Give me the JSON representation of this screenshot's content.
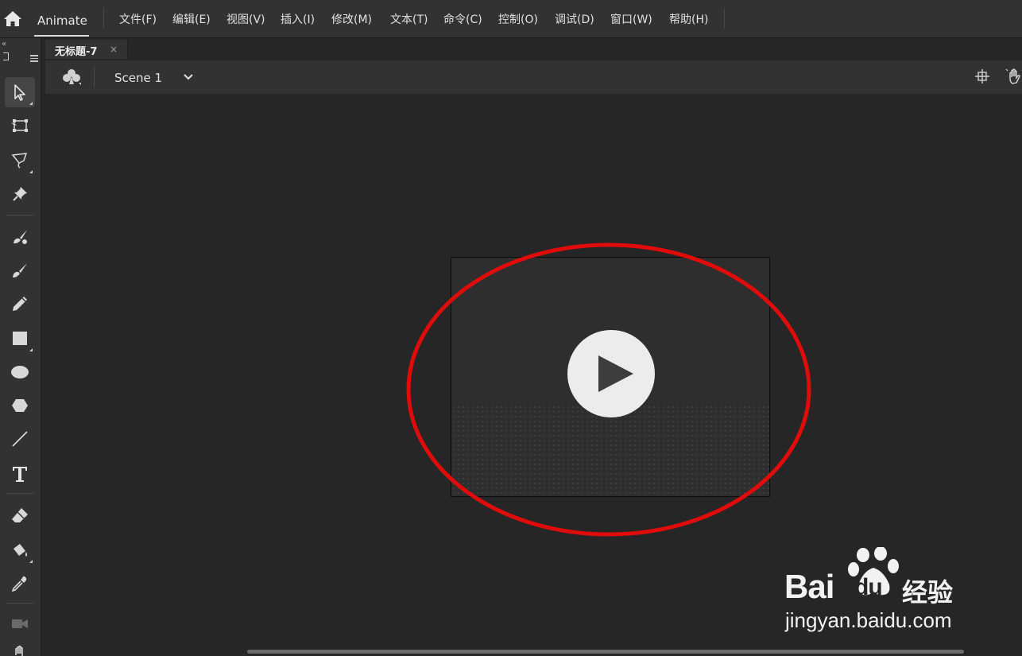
{
  "app": {
    "name": "Animate"
  },
  "menu": {
    "items": [
      {
        "label": "文件(F)"
      },
      {
        "label": "编辑(E)"
      },
      {
        "label": "视图(V)"
      },
      {
        "label": "插入(I)"
      },
      {
        "label": "修改(M)"
      },
      {
        "label": "文本(T)"
      },
      {
        "label": "命令(C)"
      },
      {
        "label": "控制(O)"
      },
      {
        "label": "调试(D)"
      },
      {
        "label": "窗口(W)"
      },
      {
        "label": "帮助(H)"
      }
    ]
  },
  "tools_panel": {
    "collapse_glyph": "«",
    "tools": [
      {
        "icon": "selection-arrow-icon",
        "active": true
      },
      {
        "icon": "free-transform-icon"
      },
      {
        "icon": "lasso-icon"
      },
      {
        "icon": "pin-icon"
      },
      {
        "icon": "fluid-brush-icon"
      },
      {
        "icon": "paint-brush-icon"
      },
      {
        "icon": "pencil-icon"
      },
      {
        "icon": "rectangle-icon"
      },
      {
        "icon": "oval-icon"
      },
      {
        "icon": "polystar-icon"
      },
      {
        "icon": "line-icon"
      },
      {
        "icon": "text-tool-icon",
        "glyph": "T"
      },
      {
        "icon": "eraser-icon"
      },
      {
        "icon": "paint-bucket-icon"
      },
      {
        "icon": "eyedropper-icon"
      },
      {
        "icon": "camera-icon"
      },
      {
        "icon": "hand-icon"
      }
    ]
  },
  "document": {
    "tab_label": "无标题-7",
    "tab_close": "×"
  },
  "edit_bar": {
    "scene_icon": "club-icon",
    "scene_label": "Scene 1",
    "snap_icon": "crosshair-icon",
    "hand_icon": "hand-tool-icon"
  },
  "stage": {
    "play_icon": "play-icon",
    "annotation_color": "#e00c0c"
  },
  "watermark": {
    "brand": "Bai",
    "brand_du": "du",
    "cn": "经验",
    "url": "jingyan.baidu.com"
  },
  "colors": {
    "menubar": "#323232",
    "pasteboard": "#262626",
    "stage": "#2e2e2e",
    "annotation": "#e00c0c"
  }
}
